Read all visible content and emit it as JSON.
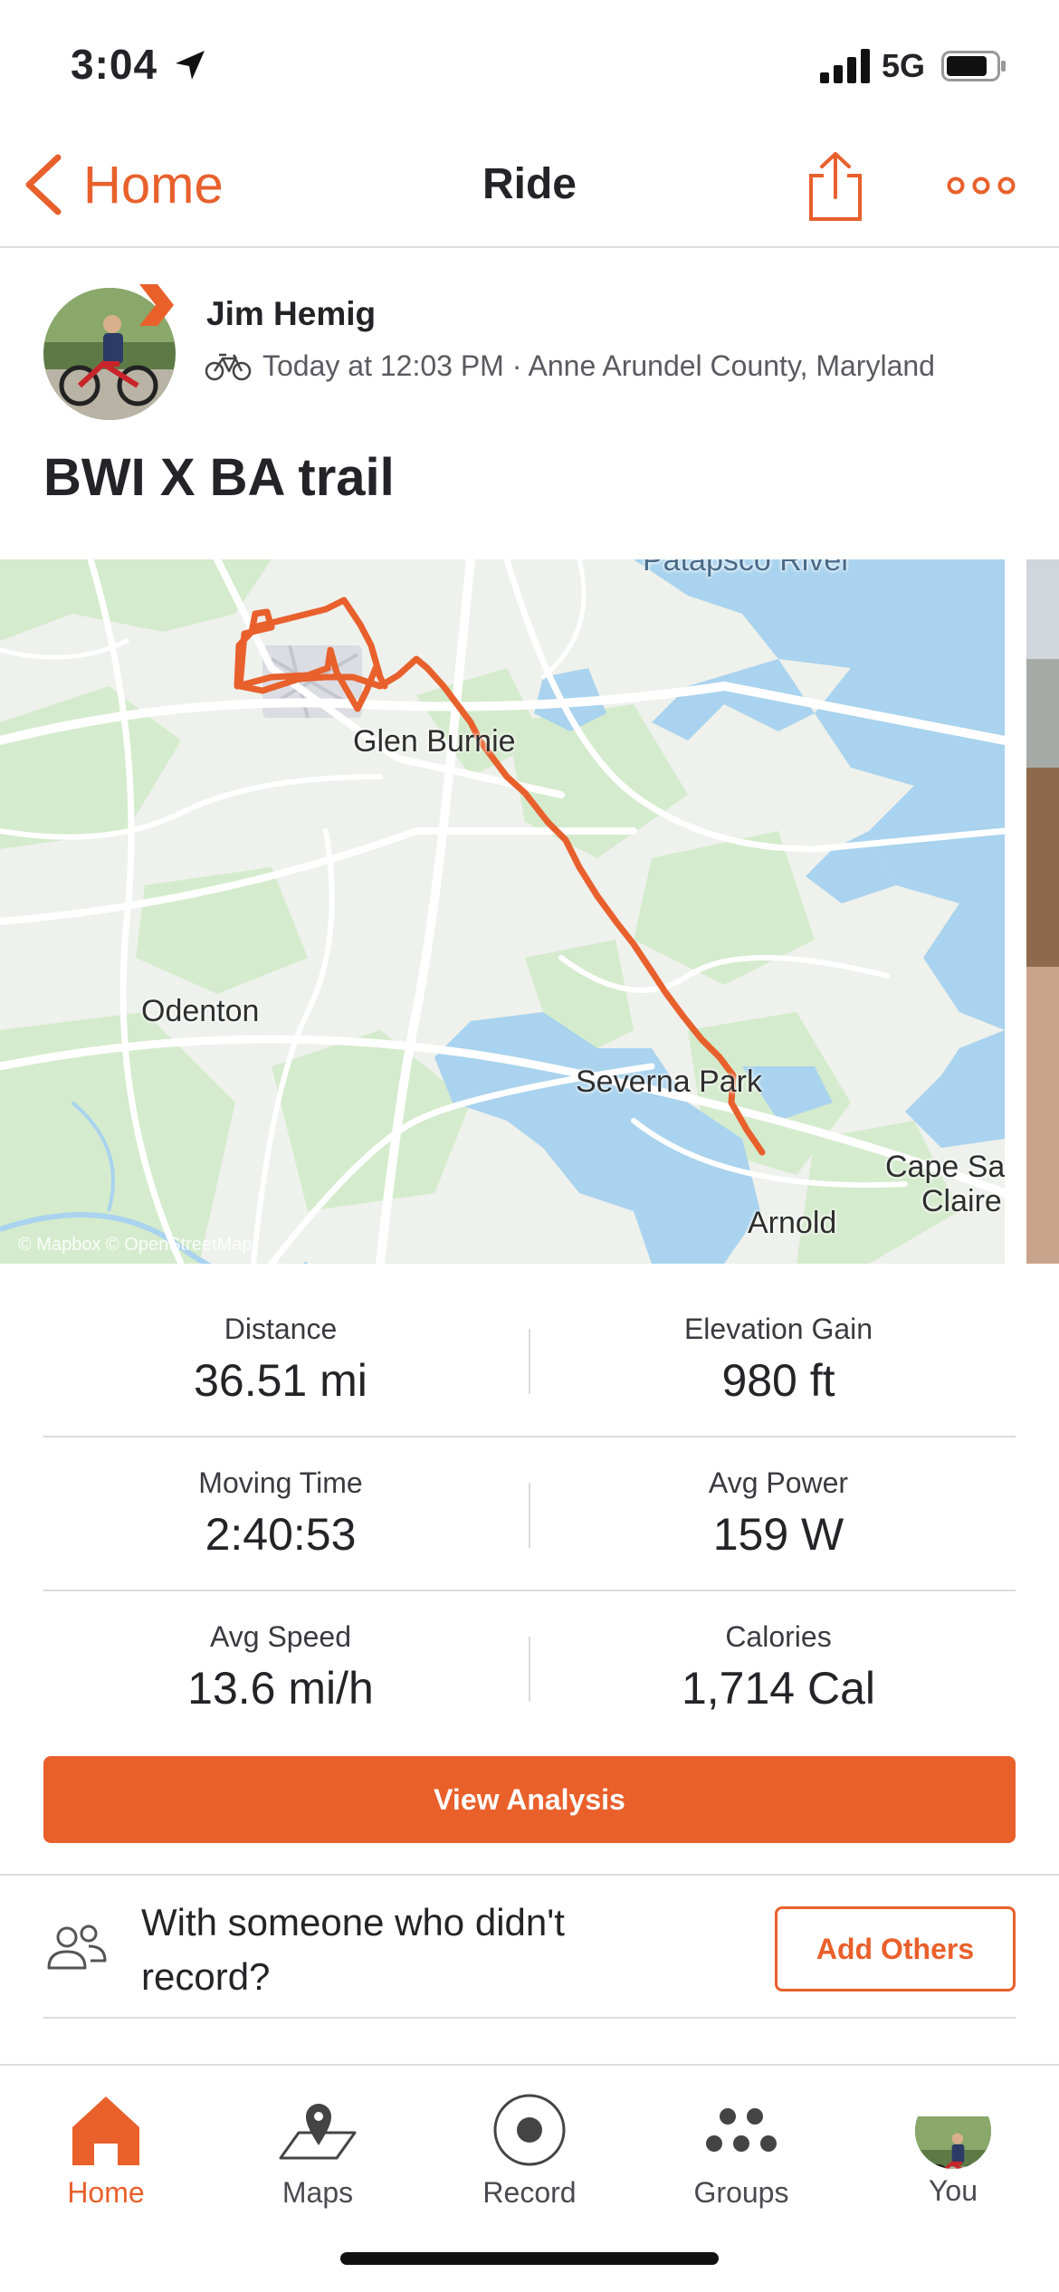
{
  "status_bar": {
    "time": "3:04",
    "network": "5G"
  },
  "nav": {
    "back_label": "Home",
    "title": "Ride"
  },
  "athlete": {
    "name": "Jim Hemig",
    "meta": "Today at 12:03 PM · Anne Arundel County, Maryland"
  },
  "activity": {
    "title": "BWI X BA trail"
  },
  "map": {
    "labels": {
      "river": "Patapsco River",
      "glen_burnie": "Glen Burnie",
      "odenton": "Odenton",
      "severna_park": "Severna Park",
      "cape": "Cape Sai",
      "claire": "Claire",
      "arnold": "Arnold"
    },
    "attribution": "© Mapbox © OpenStreetMap",
    "route_color": "#e8602c"
  },
  "stats": [
    {
      "label": "Distance",
      "value": "36.51 mi"
    },
    {
      "label": "Elevation Gain",
      "value": "980 ft"
    },
    {
      "label": "Moving Time",
      "value": "2:40:53"
    },
    {
      "label": "Avg Power",
      "value": "159 W"
    },
    {
      "label": "Avg Speed",
      "value": "13.6 mi/h"
    },
    {
      "label": "Calories",
      "value": "1,714 Cal"
    }
  ],
  "buttons": {
    "view_analysis": "View Analysis",
    "add_others": "Add Others"
  },
  "with_someone": "With someone who didn't record?",
  "tabbar": {
    "items": [
      {
        "label": "Home",
        "icon": "home-icon",
        "active": true
      },
      {
        "label": "Maps",
        "icon": "maps-icon",
        "active": false
      },
      {
        "label": "Record",
        "icon": "record-icon",
        "active": false
      },
      {
        "label": "Groups",
        "icon": "groups-icon",
        "active": false
      },
      {
        "label": "You",
        "icon": "avatar",
        "active": false
      }
    ]
  },
  "colors": {
    "accent": "#e9602b",
    "text": "#242428",
    "divider": "#dcdcde"
  }
}
